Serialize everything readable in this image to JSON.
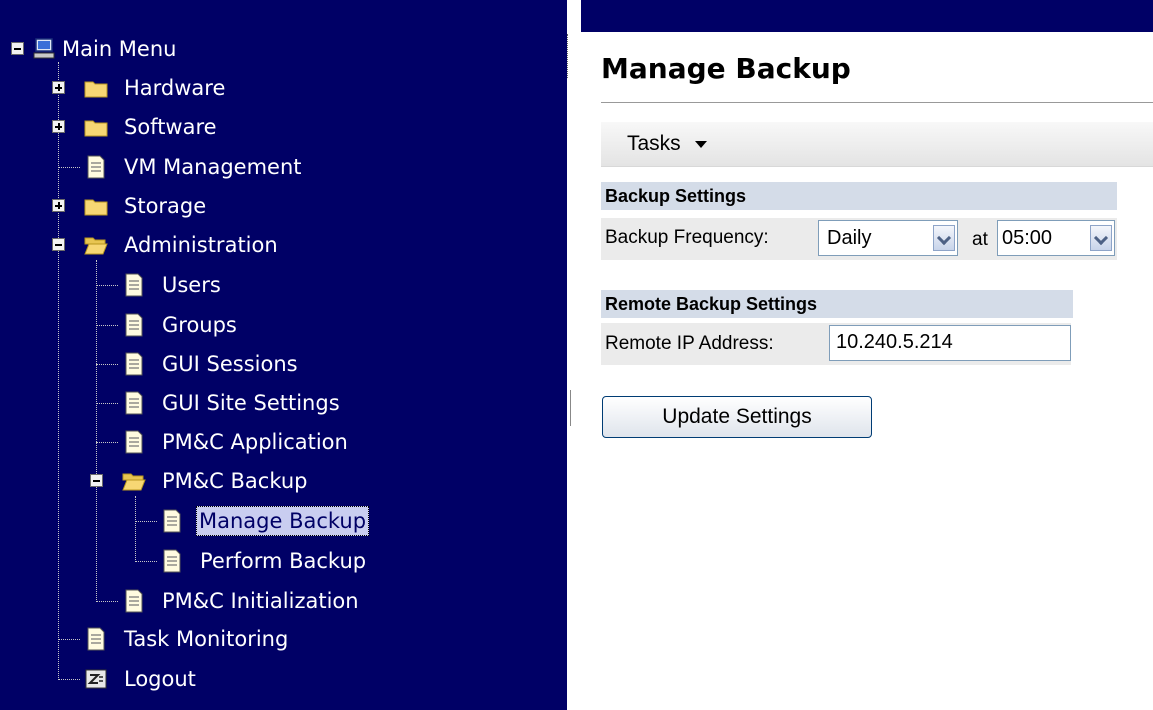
{
  "tree": {
    "root": {
      "label": "Main Menu",
      "icon": "computer-icon"
    },
    "items": [
      {
        "label": "Hardware",
        "icon": "folder-icon",
        "expander": "plus"
      },
      {
        "label": "Software",
        "icon": "folder-icon",
        "expander": "plus"
      },
      {
        "label": "VM Management",
        "icon": "document-icon"
      },
      {
        "label": "Storage",
        "icon": "folder-icon",
        "expander": "plus"
      },
      {
        "label": "Administration",
        "icon": "folder-open-icon",
        "expander": "minus"
      },
      {
        "label": "Users",
        "icon": "document-icon"
      },
      {
        "label": "Groups",
        "icon": "document-icon"
      },
      {
        "label": "GUI Sessions",
        "icon": "document-icon"
      },
      {
        "label": "GUI Site Settings",
        "icon": "document-icon"
      },
      {
        "label": "PM&C Application",
        "icon": "document-icon"
      },
      {
        "label": "PM&C Backup",
        "icon": "folder-open-icon",
        "expander": "minus"
      },
      {
        "label": "Manage Backup",
        "icon": "document-icon",
        "selected": true
      },
      {
        "label": "Perform Backup",
        "icon": "document-icon"
      },
      {
        "label": "PM&C Initialization",
        "icon": "document-icon"
      },
      {
        "label": "Task Monitoring",
        "icon": "document-icon"
      },
      {
        "label": "Logout",
        "icon": "logout-icon"
      }
    ]
  },
  "main": {
    "title": "Manage Backup",
    "tasks_label": "Tasks",
    "backup_settings": {
      "heading": "Backup Settings",
      "frequency_label": "Backup Frequency:",
      "frequency_value": "Daily",
      "at_label": "at",
      "time_value": "05:00"
    },
    "remote_settings": {
      "heading": "Remote Backup Settings",
      "ip_label": "Remote IP Address:",
      "ip_value": "10.240.5.214"
    },
    "update_button": "Update Settings"
  },
  "colors": {
    "tree_background": "#000066",
    "selected_background": "#c9cdf0",
    "section_header": "#d4dce8"
  }
}
